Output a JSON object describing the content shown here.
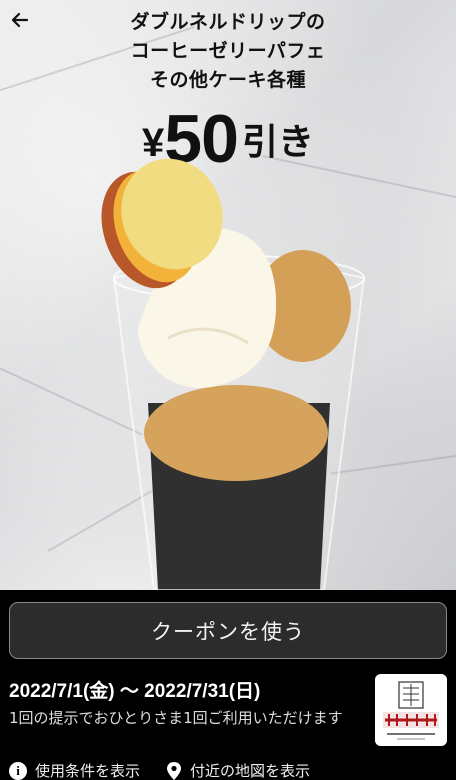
{
  "promo": {
    "title_line1": "ダブルネルドリップの",
    "title_line2": "コーヒーゼリーパフェ",
    "title_line3": "その他ケーキ各種",
    "yen": "¥",
    "discount": "50",
    "suffix": "引き"
  },
  "use_button_label": "クーポンを使う",
  "validity": "2022/7/1(金) 〜 2022/7/31(日)",
  "usage_note": "1回の提示でおひとりさま1回ご利用いただけます",
  "logo": {
    "name": "上島珈琲店",
    "tagline": "Ueshima Coffee Quality"
  },
  "links": {
    "terms": "使用条件を表示",
    "map": "付近の地図を表示"
  },
  "icons": {
    "back": "arrow-left-icon",
    "info": "info-icon",
    "map": "map-pin-icon"
  },
  "colors": {
    "background": "#000000",
    "button_bg": "#2c2c2c",
    "button_border": "#8a8a8a",
    "logo_red": "#b0181c"
  }
}
